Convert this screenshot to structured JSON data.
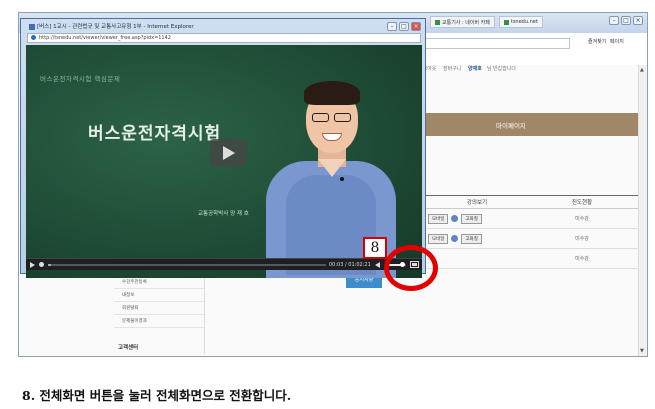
{
  "background_window": {
    "tabs": [
      "교통기사 : 네이버 카페",
      "tsnedu.net"
    ],
    "toolbar": {
      "favorites": "즐겨찾기",
      "page": "페이지"
    },
    "top_nav": [
      "로그아웃",
      "장바구니",
      "님 반갑습니다"
    ],
    "user_name": "양재호",
    "banner_label": "마이페이지",
    "table": {
      "headers": [
        "강의보기",
        "진도현황"
      ],
      "rows": [
        {
          "mobile": "모바일",
          "hd": "고화질",
          "progress": "미수강"
        },
        {
          "mobile": "모바일",
          "hd": "고화질",
          "progress": "미수강"
        },
        {
          "mobile": "",
          "hd": "",
          "progress": "미수강"
        }
      ]
    },
    "left_menu": [
      "수강주관등록",
      "내정보",
      "회원탈퇴",
      "문제풀이결과"
    ],
    "customer_center": "고객센터",
    "blue_button": "공지사항"
  },
  "popup": {
    "title": "[버스] 1교시 - 관련법규 및 교통사고유형 1부 - Internet Explorer",
    "url": "http://tsnedu.net/viewer/viewer_free.asp?pidx=1142",
    "video": {
      "board_top_text": "버스운전자격시험 핵심문제",
      "board_title": "버스운전자격시험",
      "board_credit": "교통공학박사 양 재 호",
      "time_current": "00:03",
      "time_total": "01:02:21",
      "progress_fraction": 0.01,
      "volume_fraction": 0.7
    }
  },
  "annotation": {
    "step_number": "8",
    "caption": "8. 전체화면 버튼을 눌러 전체화면으로 전환합니다."
  },
  "colors": {
    "highlight": "#e30000",
    "banner": "#a08767",
    "chalkboard": "#1f4c36"
  }
}
